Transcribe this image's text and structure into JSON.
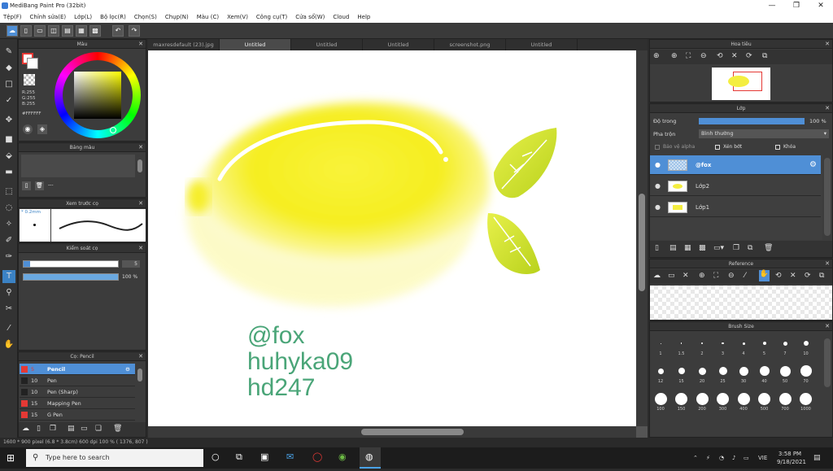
{
  "window": {
    "title": "MediBang Paint Pro (32bit)",
    "minimize": "—",
    "restore": "❐",
    "close": "✕"
  },
  "menu": [
    "Tệp(F)",
    "Chỉnh sửa(E)",
    "Lớp(L)",
    "Bộ lọc(R)",
    "Chọn(S)",
    "Chụp(N)",
    "Màu (C)",
    "Xem(V)",
    "Công cụ(T)",
    "Cửa sổ(W)",
    "Cloud",
    "Help"
  ],
  "tabs": [
    "maxresdefault (23).jpg",
    "Untitled",
    "Untitled",
    "Untitled",
    "screenshot.png",
    "Untitled"
  ],
  "color_panel": {
    "title": "Màu",
    "r": "R:255",
    "g": "G:255",
    "b": "B:255",
    "hex": "#FFFFFF"
  },
  "palette_panel": {
    "title": "Bảng màu",
    "dash": "---"
  },
  "brush_preview": {
    "title": "Xem trước cọ",
    "size": "0.2mm"
  },
  "brush_control": {
    "title": "Kiểm soát cọ",
    "size_value": "5",
    "opacity_value": "100 %",
    "opacity_fraction": 1.0
  },
  "brush_list": {
    "title": "Cọ: Pencil",
    "items": [
      {
        "size": "5",
        "name": "Pencil",
        "color": "#e53935"
      },
      {
        "size": "10",
        "name": "Pen",
        "color": "#222222"
      },
      {
        "size": "10",
        "name": "Pen (Sharp)",
        "color": "#222222"
      },
      {
        "size": "15",
        "name": "Mapping Pen",
        "color": "#e53935"
      },
      {
        "size": "15",
        "name": "G Pen",
        "color": "#e53935"
      }
    ]
  },
  "navigator": {
    "title": "Hoa tiêu"
  },
  "layers_panel": {
    "title": "Lớp",
    "opacity_label": "Độ trong",
    "opacity_value": "100 %",
    "blend_label": "Pha trộn",
    "blend_value": "Bình thường",
    "protect_alpha": "Bảo vệ alpha",
    "clipping": "Xén bớt",
    "lock": "Khóa",
    "layers": [
      {
        "name": "@fox",
        "selected": true
      },
      {
        "name": "Lớp2",
        "selected": false
      },
      {
        "name": "Lớp1",
        "selected": false
      }
    ]
  },
  "reference": {
    "title": "Reference"
  },
  "brush_size": {
    "title": "Brush Size",
    "labels": [
      "1",
      "1.5",
      "2",
      "3",
      "4",
      "5",
      "7",
      "10",
      "12",
      "15",
      "20",
      "25",
      "30",
      "40",
      "50",
      "70",
      "100",
      "150",
      "200",
      "300",
      "400",
      "500",
      "700",
      "1000"
    ]
  },
  "canvas_text": [
    "@fox",
    "huhyka09",
    "hd247"
  ],
  "status": "1600 * 900 pixel   (6.8 * 3.8cm)   600 dpi   100 %   ( 1376, 807 )",
  "taskbar": {
    "search_placeholder": "Type here to search",
    "lang": "VIE",
    "time": "3:58 PM",
    "date": "9/18/2021"
  }
}
